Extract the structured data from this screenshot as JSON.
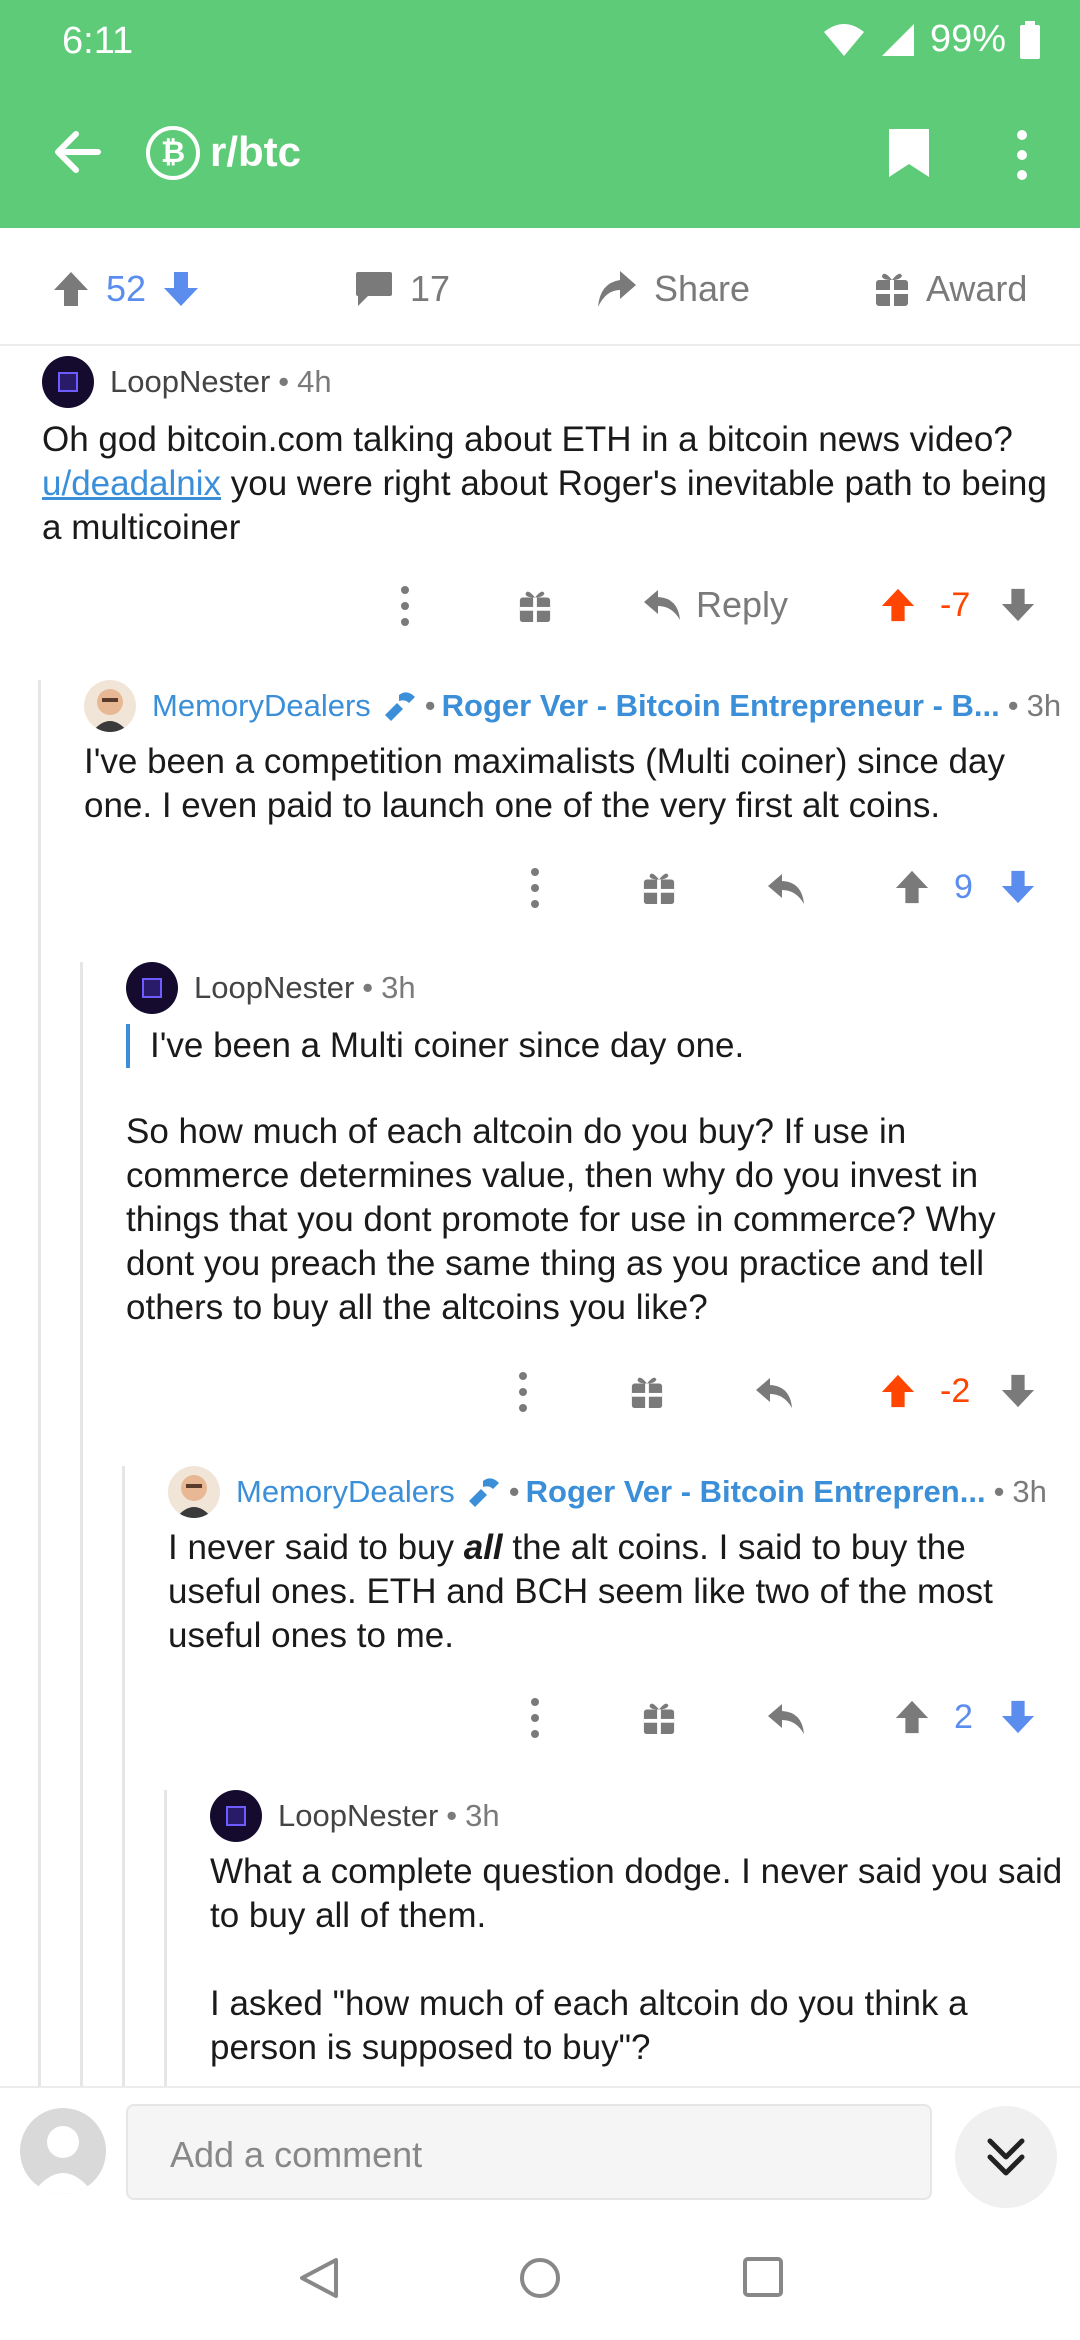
{
  "status_bar": {
    "time": "6:11",
    "battery": "99%"
  },
  "app_bar": {
    "subreddit": "r/btc",
    "sub_icon_glyph": "₿"
  },
  "post_actions": {
    "score": "52",
    "comments": "17",
    "share": "Share",
    "award": "Award"
  },
  "comments": [
    {
      "author": "LoopNester",
      "age": "4h",
      "body_before_link": "Oh god bitcoin.com talking about ETH in a bitcoin news video? ",
      "link": "u/deadalnix",
      "body_after_link": " you were right about Roger's inevitable path to being a multicoiner",
      "reply_label": "Reply",
      "score": "-7"
    },
    {
      "author": "MemoryDealers",
      "flair": "Roger Ver - Bitcoin Entrepreneur - B...",
      "age": "3h",
      "body": "I've been a competition maximalists (Multi coiner) since day one. I even paid to launch one of the very first alt coins.",
      "score": "9"
    },
    {
      "author": "LoopNester",
      "age": "3h",
      "quote": "I've been a Multi coiner since day one.",
      "body": "So how much of each altcoin do you buy? If use in commerce determines value, then why do you invest in things that you dont promote for use in commerce? Why dont you preach the same thing as you practice and tell others to buy all the altcoins you like?",
      "score": "-2"
    },
    {
      "author": "MemoryDealers",
      "flair": "Roger Ver - Bitcoin Entrepren...",
      "age": "3h",
      "body_before_em": "I never said to buy ",
      "em": "all",
      "body_after_em": " the alt coins.  I said to buy the useful ones.  ETH and BCH seem like two of the most useful ones to me.",
      "score": "2"
    },
    {
      "author": "LoopNester",
      "age": "3h",
      "body1": "What a complete question dodge. I never said you said to buy all of them.",
      "body2": "I asked \"how much of each altcoin do you think a person is supposed to buy\"?"
    }
  ],
  "meta_separator": "•",
  "comment_bar": {
    "placeholder": "Add a comment"
  },
  "colors": {
    "header_green": "#5ecb78",
    "upvote_orange": "#ff4500",
    "vote_blue": "#5b8def",
    "link_blue": "#3a8fd8"
  }
}
